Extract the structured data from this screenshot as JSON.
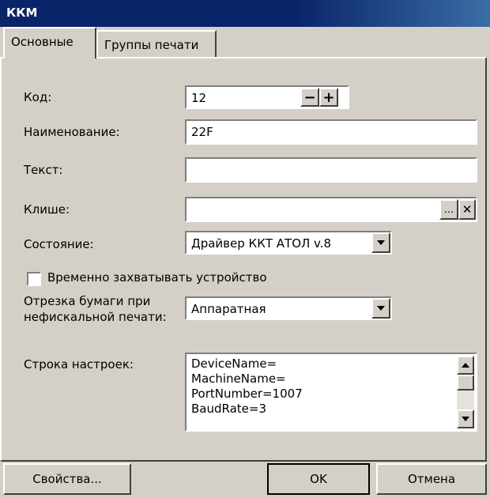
{
  "window": {
    "title": "ККМ"
  },
  "tabs": [
    {
      "label": "Основные",
      "active": true
    },
    {
      "label": "Группы печати",
      "active": false
    }
  ],
  "form": {
    "code": {
      "label": "Код:",
      "value": "12",
      "minus": "−",
      "plus": "+"
    },
    "name": {
      "label": "Наименование:",
      "value": "22F"
    },
    "text": {
      "label": "Текст:",
      "value": ""
    },
    "cliche": {
      "label": "Клише:",
      "value": "",
      "browse": "...",
      "clear": "✕"
    },
    "state": {
      "label": "Состояние:",
      "value": "Драйвер ККТ АТОЛ v.8"
    },
    "capture": {
      "label": "Временно захватывать устройство",
      "checked": false
    },
    "paper_cut": {
      "label_line1": "Отрезка бумаги при",
      "label_line2": "нефискальной печати:",
      "value": "Аппаратная"
    },
    "settings": {
      "label": "Строка настроек:",
      "lines": [
        "DeviceName=",
        "MachineName=",
        "PortNumber=1007",
        "BaudRate=3"
      ]
    }
  },
  "footer": {
    "properties": "Свойства...",
    "ok": "OK",
    "cancel": "Отмена"
  }
}
